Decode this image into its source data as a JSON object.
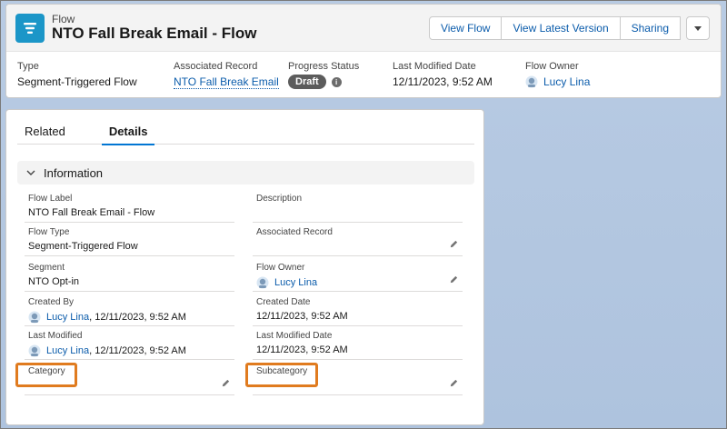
{
  "header": {
    "object_label": "Flow",
    "record_title": "NTO Fall Break Email - Flow",
    "buttons": [
      "View Flow",
      "View Latest Version",
      "Sharing"
    ],
    "menu_icon": "chevron-down-icon"
  },
  "highlights": [
    {
      "label": "Type",
      "value": "Segment-Triggered Flow"
    },
    {
      "label": "Associated Record",
      "value": "NTO Fall Break Email"
    },
    {
      "label": "Progress Status",
      "value": "Draft"
    },
    {
      "label": "Last Modified Date",
      "value": "12/11/2023, 9:52 AM"
    },
    {
      "label": "Flow Owner",
      "value": "Lucy Lina"
    }
  ],
  "tabs": [
    "Related",
    "Details"
  ],
  "section": {
    "title": "Information"
  },
  "fields": {
    "flow_label": {
      "label": "Flow Label",
      "value": "NTO Fall Break Email - Flow"
    },
    "description": {
      "label": "Description",
      "value": ""
    },
    "flow_type": {
      "label": "Flow Type",
      "value": "Segment-Triggered Flow"
    },
    "associated_record": {
      "label": "Associated Record",
      "value": ""
    },
    "segment": {
      "label": "Segment",
      "value": "NTO Opt-in"
    },
    "flow_owner": {
      "label": "Flow Owner",
      "value": "Lucy Lina"
    },
    "created_by": {
      "label": "Created By",
      "user": "Lucy Lina",
      "date": ", 12/11/2023, 9:52 AM"
    },
    "created_date": {
      "label": "Created Date",
      "value": "12/11/2023, 9:52 AM"
    },
    "last_modified": {
      "label": "Last Modified",
      "user": "Lucy Lina",
      "date": ", 12/11/2023, 9:52 AM"
    },
    "last_modified_date": {
      "label": "Last Modified Date",
      "value": "12/11/2023, 9:52 AM"
    },
    "category": {
      "label": "Category",
      "value": ""
    },
    "subcategory": {
      "label": "Subcategory",
      "value": ""
    }
  },
  "colors": {
    "brand": "#0176d3",
    "link": "#0b5cab",
    "highlight_box": "#e07b1f",
    "app_icon": "#1b96c8"
  }
}
